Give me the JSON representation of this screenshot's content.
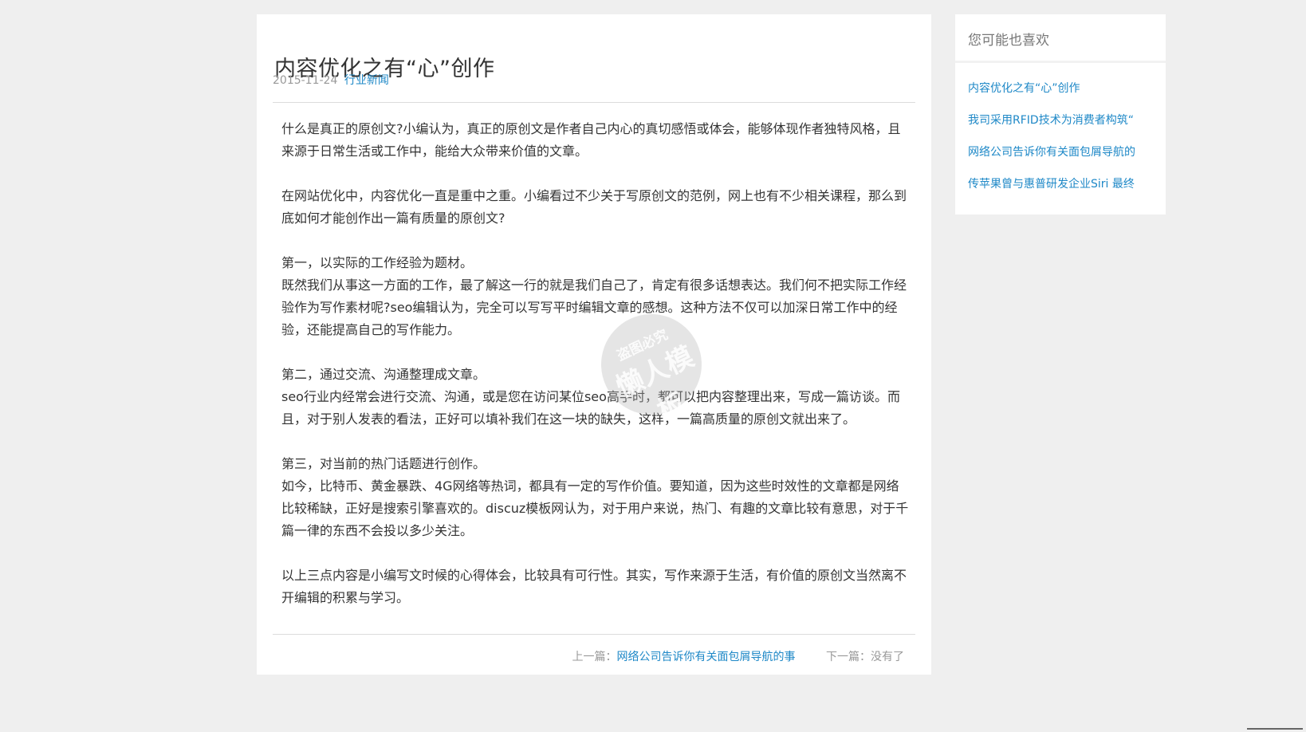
{
  "article": {
    "title": "内容优化之有“心”创作",
    "date": "2015-11-24",
    "category": "行业新闻",
    "paragraphs": [
      "什么是真正的原创文?小编认为，真正的原创文是作者自己内心的真切感悟或体会，能够体现作者独特风格，且来源于日常生活或工作中，能给大众带来价值的文章。",
      "在网站优化中，内容优化一直是重中之重。小编看过不少关于写原创文的范例，网上也有不少相关课程，那么到底如何才能创作出一篇有质量的原创文?",
      "第一，以实际的工作经验为题材。",
      "既然我们从事这一方面的工作，最了解这一行的就是我们自己了，肯定有很多话想表达。我们何不把实际工作经验作为写作素材呢?seo编辑认为，完全可以写写平时编辑文章的感想。这种方法不仅可以加深日常工作中的经验，还能提高自己的写作能力。",
      "第二，通过交流、沟通整理成文章。",
      "seo行业内经常会进行交流、沟通，或是您在访问某位seo高手时，都可以把内容整理出来，写成一篇访谈。而且，对于别人发表的看法，正好可以填补我们在这一块的缺失，这样，一篇高质量的原创文就出来了。",
      "第三，对当前的热门话题进行创作。",
      "如今，比特币、黄金暴跌、4G网络等热词，都具有一定的写作价值。要知道，因为这些时效性的文章都是网络比较稀缺，正好是搜索引擎喜欢的。discuz模板网认为，对于用户来说，热门、有趣的文章比较有意思，对于千篇一律的东西不会投以多少关注。",
      "以上三点内容是小编写文时候的心得体会，比较具有可行性。其实，写作来源于生活，有价值的原创文当然离不开编辑的积累与学习。"
    ]
  },
  "pager": {
    "prev_label": "上一篇：",
    "prev_title": "网络公司告诉你有关面包屑导航的事",
    "next_label": "下一篇：",
    "next_value": "没有了"
  },
  "sidebar": {
    "title": "您可能也喜欢",
    "items": [
      "内容优化之有“心”创作",
      "我司采用RFID技术为消费者构筑“",
      "网络公司告诉你有关面包屑导航的",
      "传苹果曾与惠普研发企业Siri 最终"
    ]
  },
  "watermark": {
    "line1": "盗图必究",
    "line2": "懒人模板"
  },
  "colors": {
    "link": "#1e88c7",
    "background": "#efefef"
  }
}
